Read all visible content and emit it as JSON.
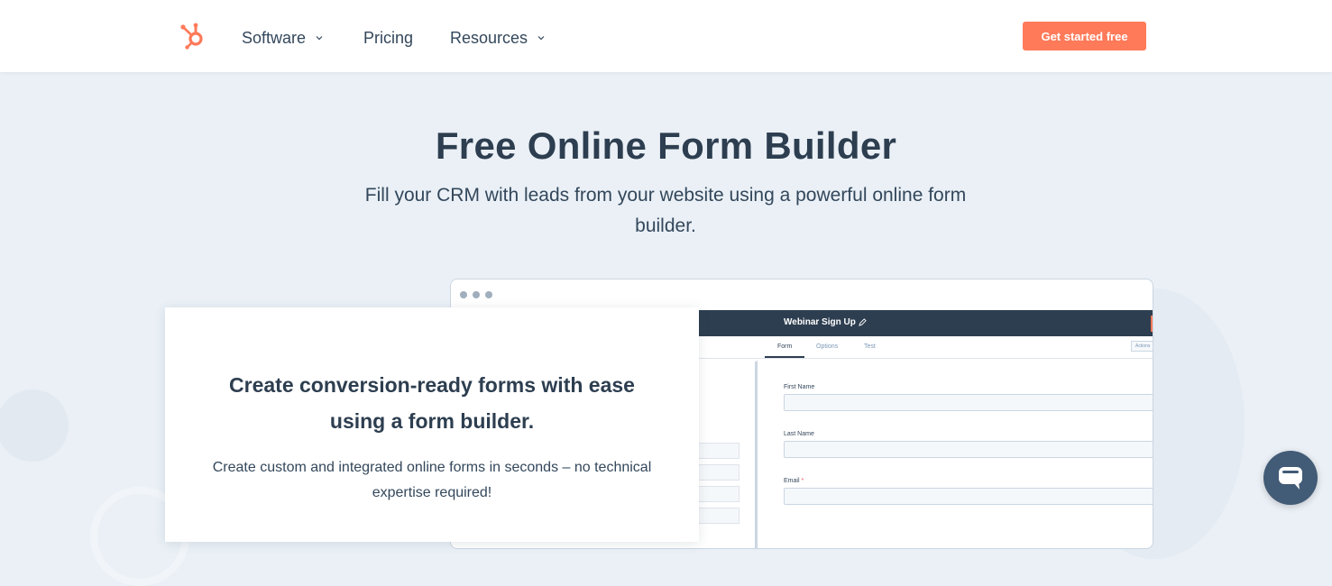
{
  "header": {
    "nav": [
      {
        "label": "Software",
        "has_dropdown": true
      },
      {
        "label": "Pricing",
        "has_dropdown": false
      },
      {
        "label": "Resources",
        "has_dropdown": true
      }
    ],
    "cta_label": "Get started free",
    "logo_icon": "hubspot-sprocket-icon"
  },
  "hero": {
    "title": "Free Online Form Builder",
    "subtitle": "Fill your CRM with leads from your website using a powerful online form builder."
  },
  "app_mock": {
    "form_name": "Webinar Sign Up",
    "tabs": [
      "Form",
      "Options",
      "Test"
    ],
    "active_tab": "Form",
    "actions_label": "Actions",
    "fields": [
      {
        "label": "First Name",
        "required": false
      },
      {
        "label": "Last Name",
        "required": false
      },
      {
        "label": "Email",
        "required": true
      }
    ],
    "required_marker": "*"
  },
  "card": {
    "title": "Create conversion-ready forms with ease using a form builder.",
    "text": "Create custom and integrated online forms in seconds – no technical expertise required!"
  },
  "colors": {
    "accent": "#ff7a59",
    "navy": "#2d3e50",
    "text": "#33475b",
    "background": "#eaf0f6",
    "chat": "#425b76"
  }
}
